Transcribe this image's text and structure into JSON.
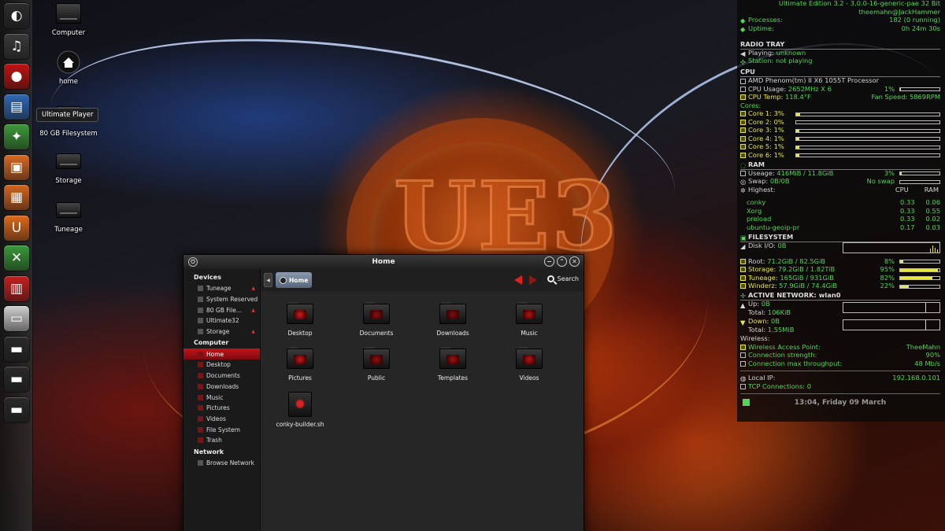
{
  "launcher": {
    "items": [
      {
        "name": "launcher-dash-icon",
        "bg": "#2c2c2c",
        "glyph": "◐"
      },
      {
        "name": "launcher-ultimate-player-icon",
        "bg": "#3a3a3a",
        "glyph": "♫"
      },
      {
        "name": "launcher-media-icon",
        "bg": "#c21212",
        "glyph": "●"
      },
      {
        "name": "launcher-writer-icon",
        "bg": "#2f69b4",
        "glyph": "▤"
      },
      {
        "name": "launcher-maps-icon",
        "bg": "#3e9a3a",
        "glyph": "✦"
      },
      {
        "name": "launcher-presentation-icon",
        "bg": "#d86a24",
        "glyph": "▣"
      },
      {
        "name": "launcher-store-icon",
        "bg": "#d4661e",
        "glyph": "▦"
      },
      {
        "name": "launcher-ubuntu-one-icon",
        "bg": "#e06a18",
        "glyph": "U"
      },
      {
        "name": "launcher-settings-icon",
        "bg": "#3a9a3a",
        "glyph": "✕"
      },
      {
        "name": "launcher-workspace-icon",
        "bg": "#c42020",
        "glyph": "▥"
      },
      {
        "name": "launcher-window-icon",
        "bg": "#cfcfcf",
        "glyph": "▭"
      },
      {
        "name": "launcher-drive-icon-1",
        "bg": "#2a2a2a",
        "glyph": "▬"
      },
      {
        "name": "launcher-drive-icon-2",
        "bg": "#2a2a2a",
        "glyph": "▬"
      },
      {
        "name": "launcher-drive-icon-3",
        "bg": "#2a2a2a",
        "glyph": "▬"
      }
    ]
  },
  "desktop": {
    "icons": {
      "computer": "Computer",
      "home": "home",
      "filesystem": "80 GB Filesystem",
      "storage": "Storage",
      "tuneage": "Tuneage"
    },
    "tooltip": "Ultimate Player"
  },
  "file_manager": {
    "title": "Home",
    "breadcrumb": "Home",
    "search_label": "Search",
    "devices_header": "Devices",
    "devices": [
      "Tuneage",
      "System Reserved",
      "80 GB File...",
      "Ultimate32",
      "Storage"
    ],
    "computer_header": "Computer",
    "places": [
      "Home",
      "Desktop",
      "Documents",
      "Downloads",
      "Music",
      "Pictures",
      "Videos",
      "File System",
      "Trash"
    ],
    "network_header": "Network",
    "network": [
      "Browse Network"
    ],
    "files": [
      "Desktop",
      "Documents",
      "Downloads",
      "Music",
      "Pictures",
      "Public",
      "Templates",
      "Videos",
      "conky-builder.sh"
    ]
  },
  "conky": {
    "edition": "Ultimate Edition 3.2 - 3.0.0-16-generic-pae 32 Bit",
    "user": "theemahn@JackHammer",
    "processes_label": "Processes:",
    "processes_value": "182 (0 running)",
    "uptime_label": "Uptime:",
    "uptime_value": "0h 24m 30s",
    "radio_header": "RADIO TRAY",
    "playing_label": "Playing:",
    "playing_value": "unknown",
    "station_label": "Station:",
    "station_value": "not playing",
    "cpu_header": "CPU",
    "cpu_model": "AMD Phenom(tm) II X6 1055T Processor",
    "cpu_usage_label": "CPU Usage:",
    "cpu_usage_value": "2652MHz X 6",
    "cpu_usage_pct": "1%",
    "cpu_usage_fill": 1,
    "cpu_temp_label": "CPU Temp:",
    "cpu_temp_value": "118.4°F",
    "fan_label": "Fan Speed:",
    "fan_value": "5869RPM",
    "cores_label": "Cores:",
    "cores": [
      {
        "label": "Core 1:",
        "value": "3%",
        "fill": 3
      },
      {
        "label": "Core 2:",
        "value": "0%",
        "fill": 0
      },
      {
        "label": "Core 3:",
        "value": "1%",
        "fill": 1
      },
      {
        "label": "Core 4:",
        "value": "1%",
        "fill": 1
      },
      {
        "label": "Core 5:",
        "value": "1%",
        "fill": 1
      },
      {
        "label": "Core 6:",
        "value": "1%",
        "fill": 1
      }
    ],
    "ram_header": "RAM",
    "usage_label": "Useage:",
    "usage_value": "416MiB / 11.8GiB",
    "usage_pct": "3%",
    "usage_fill": 3,
    "swap_label": "Swap:",
    "swap_value": "0B/0B",
    "swap_status": "No swap",
    "highest_label": "Highest:",
    "col_cpu": "CPU",
    "col_ram": "RAM",
    "procs": [
      {
        "name": "conky",
        "cpu": "0.33",
        "ram": "0.06"
      },
      {
        "name": "Xorg",
        "cpu": "0.33",
        "ram": "0.55"
      },
      {
        "name": "preload",
        "cpu": "0.33",
        "ram": "0.02"
      },
      {
        "name": "ubuntu-geoip-pr",
        "cpu": "0.17",
        "ram": "0.03"
      }
    ],
    "fs_header": "FILESYSTEM",
    "disk_io_label": "Disk I/O:",
    "disk_io_value": "0B",
    "filesystems": [
      {
        "label": "Root:",
        "value": "71.2GiB / 82.5GiB",
        "pct": "8%",
        "fill": 8
      },
      {
        "label": "Storage:",
        "value": "79.2GiB / 1.82TiB",
        "pct": "95%",
        "fill": 95
      },
      {
        "label": "Tuneage:",
        "value": "165GiB / 931GiB",
        "pct": "82%",
        "fill": 82
      },
      {
        "label": "Winderz:",
        "value": "57.9GiB / 74.4GiB",
        "pct": "22%",
        "fill": 22
      }
    ],
    "net_header": "ACTIVE NETWORK: wlan0",
    "up_label": "Up:",
    "up_value": "0B",
    "up_total_label": "Total:",
    "up_total_value": "106KiB",
    "down_label": "Down:",
    "down_value": "0B",
    "down_total_label": "Total:",
    "down_total_value": "1.55MiB",
    "wireless_label": "Wireless:",
    "ap_label": "Wireless Access Point:",
    "ap_value": "TheeMahn",
    "strength_label": "Connection strength:",
    "strength_value": "90%",
    "throughput_label": "Connection max throughput:",
    "throughput_value": "48 Mb/s",
    "local_ip_label": "Local IP:",
    "local_ip_value": "192.168.0.101",
    "tcp_label": "TCP Connections:",
    "tcp_value": "0",
    "clock": "13:04, Friday 09 March"
  },
  "colors": {
    "accent_red": "#c4141a",
    "conky_green": "#55d455",
    "conky_yellow": "#e6e648"
  }
}
